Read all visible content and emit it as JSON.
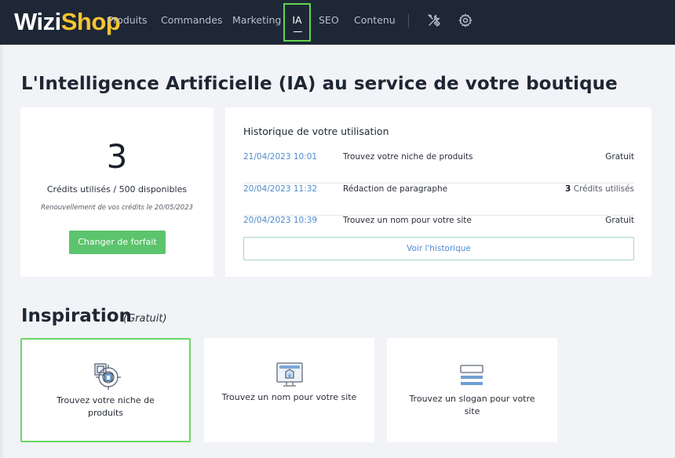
{
  "header": {
    "logo_part1": "Wizi",
    "logo_part2": "Shop",
    "nav": [
      {
        "label": "Produits"
      },
      {
        "label": "Commandes"
      },
      {
        "label": "Marketing"
      },
      {
        "label": "IA"
      },
      {
        "label": "SEO"
      },
      {
        "label": "Contenu"
      }
    ],
    "icons": [
      "tools-icon",
      "gear-icon"
    ],
    "accent_color": "#62d452"
  },
  "page": {
    "title": "L'Intelligence Artificielle (IA) au service de votre boutique"
  },
  "credits": {
    "used": "3",
    "summary": "Crédits utilisés / 500 disponibles",
    "renewal": "Renouvellement de vos crédits le 20/05/2023",
    "change_plan_label": "Changer de forfait",
    "button_color": "#5cc46c"
  },
  "history": {
    "title": "Historique de votre utilisation",
    "rows": [
      {
        "date": "21/04/2023 10:01",
        "label": "Trouvez votre niche de produits",
        "cost_num": "",
        "cost_text": "Gratuit"
      },
      {
        "date": "20/04/2023 11:32",
        "label": "Rédaction de paragraphe",
        "cost_num": "3",
        "cost_text": "Crédits utilisés"
      },
      {
        "date": "20/04/2023 10:39",
        "label": "Trouvez un nom pour votre site",
        "cost_num": "",
        "cost_text": "Gratuit"
      }
    ],
    "view_all_label": "Voir l'historique"
  },
  "inspiration": {
    "title": "Inspiration",
    "subtitle": "(Gratuit)",
    "tiles": [
      {
        "label": "Trouvez votre niche de produits",
        "icon": "target-box-icon"
      },
      {
        "label": "Trouvez un nom pour votre site",
        "icon": "monitor-icon"
      },
      {
        "label": "Trouvez un slogan pour votre site",
        "icon": "text-lines-icon"
      }
    ]
  }
}
